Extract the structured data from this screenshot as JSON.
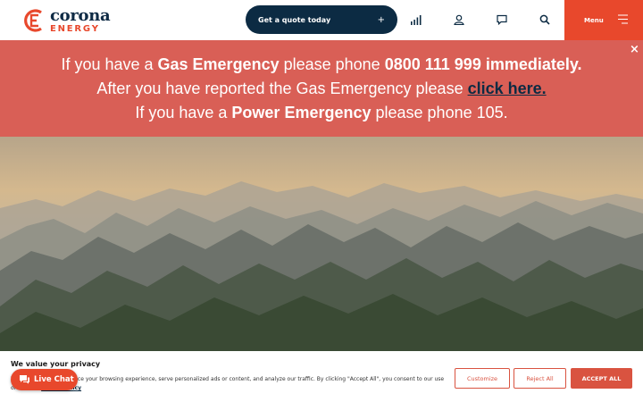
{
  "brand": {
    "name": "corona",
    "sub": "ENERGY"
  },
  "header": {
    "quote_label": "Get a quote today",
    "quote_plus": "+",
    "menu_label": "Menu"
  },
  "alert": {
    "line1_a": "If you have a ",
    "line1_b": "Gas Emergency",
    "line1_c": " please phone ",
    "line1_d": "0800 111 999 immediately.",
    "line2_a": "After you have reported the Gas Emergency please ",
    "line2_link": "click here.",
    "line3_a": "If you have a ",
    "line3_b": "Power Emergency",
    "line3_c": " please phone 105.",
    "close": "×"
  },
  "cookie": {
    "title": "We value your privacy",
    "text": "We use cookies to enhance your browsing experience, serve personalized ads or content, and analyze our traffic. By clicking \"Accept All\", you consent to our use of cookies.",
    "policy_link": "Cookie Policy",
    "customize": "Customize",
    "reject": "Reject All",
    "accept": "ACCEPT ALL"
  },
  "chat": {
    "label": "Live Chat"
  },
  "colors": {
    "navy": "#0c2b43",
    "orange": "#e8482c",
    "alert_bg": "#d95f56"
  }
}
